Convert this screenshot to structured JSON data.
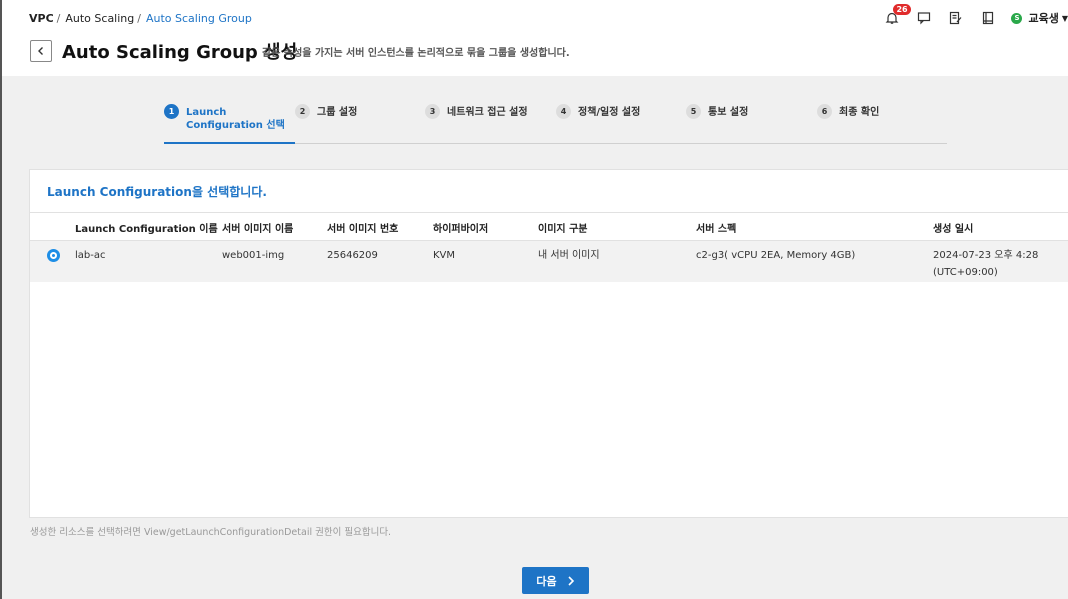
{
  "breadcrumb": {
    "items": [
      "VPC",
      "Auto Scaling",
      "Auto Scaling Group"
    ],
    "separator": "/"
  },
  "header": {
    "title": "Auto Scaling Group 생성",
    "description": "같은 속성을 가지는 서버 인스턴스를 논리적으로 묶을 그룹을 생성합니다.",
    "notification_count": "26",
    "user_name": "교육생",
    "user_initial": "S"
  },
  "steps": [
    {
      "num": "1",
      "label": "Launch Configuration 선택",
      "line1": "Launch",
      "line2": "Configuration 선택"
    },
    {
      "num": "2",
      "label": "그룹 설정"
    },
    {
      "num": "3",
      "label": "네트워크 접근 설정"
    },
    {
      "num": "4",
      "label": "정책/일정 설정"
    },
    {
      "num": "5",
      "label": "통보 설정"
    },
    {
      "num": "6",
      "label": "최종 확인"
    }
  ],
  "panel": {
    "title": "Launch Configuration을 선택합니다."
  },
  "table": {
    "columns": [
      "Launch Configuration 이름",
      "서버 이미지 이름",
      "서버 이미지 번호",
      "하이퍼바이저",
      "이미지 구분",
      "서버 스펙",
      "생성 일시"
    ],
    "rows": [
      {
        "name": "lab-ac",
        "image_name": "web001-img",
        "image_no": "25646209",
        "hypervisor": "KVM",
        "image_type": "내 서버 이미지",
        "spec": "c2-g3( vCPU 2EA, Memory 4GB)",
        "created_date": "2024-07-23 오후 4:28",
        "created_tz": "(UTC+09:00)",
        "selected": true
      }
    ]
  },
  "hint": "생성한 리소스를 선택하려면 View/getLaunchConfigurationDetail 권한이 필요합니다.",
  "next_button": "다음",
  "colors": {
    "accent": "#1e74c6",
    "radio": "#1e8ee6",
    "badge": "#e02b2b",
    "user_status": "#2aa84a"
  },
  "icons": [
    "chevron-left-icon",
    "bell-icon",
    "chat-icon",
    "edit-icon",
    "book-icon",
    "chevron-right-icon"
  ]
}
